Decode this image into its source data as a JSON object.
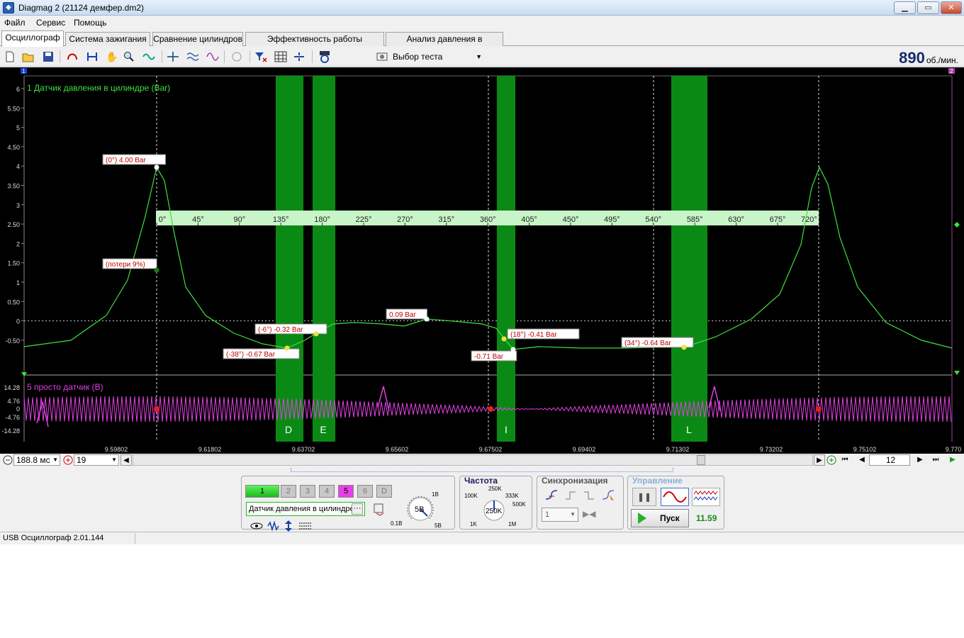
{
  "window": {
    "title": "Diagmag 2 (21124 демфер.dm2)",
    "min_label": "▁",
    "max_label": "▭",
    "close_label": "✕"
  },
  "menu": [
    "Файл",
    "Сервис",
    "Помощь"
  ],
  "tabs": [
    "Осциллограф",
    "Система зажигания",
    "Сравнение цилиндров",
    "Эффективность работы цилиндров",
    "Анализ давления в цилиндре"
  ],
  "toolbar": {
    "test_select": "Выбор теста",
    "rpm_value": "890",
    "rpm_unit": "об./мин."
  },
  "scope": {
    "channel1_label": "1 Датчик давления в цилиндре (Bar)",
    "channel5_label": "5 просто датчик (В)",
    "y_ticks_ch1": [
      "6",
      "5.50",
      "5",
      "4.50",
      "4",
      "3.50",
      "3",
      "2.50",
      "2",
      "1.50",
      "1",
      "0.50",
      "0",
      "-0.50"
    ],
    "y_ticks_ch5": [
      "14.28",
      "4.76",
      "0",
      "-4.76",
      "-14.28"
    ],
    "degree_ticks": [
      "0°",
      "45°",
      "90°",
      "135°",
      "180°",
      "225°",
      "270°",
      "315°",
      "360°",
      "405°",
      "450°",
      "495°",
      "540°",
      "585°",
      "630°",
      "675°",
      "720°"
    ],
    "time_ticks": [
      "9.59802",
      "9.61802",
      "9.63702",
      "9.65602",
      "9.67502",
      "9.69402",
      "9.71302",
      "9.73202",
      "9.75102",
      "9.770"
    ],
    "zone_letters": [
      "D",
      "E",
      "I",
      "L"
    ],
    "annotations": [
      "(0°) 4.00 Bar",
      "(потери 9%)",
      "(-6°) -0.32 Bar",
      "(-38°) -0.67 Bar",
      "0.09 Bar",
      "(18°) -0.41 Bar",
      "-0.71 Bar",
      "(34°) -0.64 Bar"
    ],
    "marker_left": "1",
    "marker_right": "2",
    "colors": {
      "ch1": "#3ee03e",
      "ch5": "#e040e0",
      "zone": "#0a8a14",
      "ruler": "#c8f5c8",
      "label_bg": "#ffffff",
      "label_fg": "#c00000"
    }
  },
  "bottom": {
    "timebase": "188.8 мс",
    "trigger_num": "19",
    "page_num": "12"
  },
  "channels": {
    "buttons": [
      "1",
      "2",
      "3",
      "4",
      "5",
      "6",
      "D"
    ],
    "sensor": "Датчик давления в цилиндре",
    "knob_value": "5В",
    "knob_min": "0.1В",
    "knob_max": "5В",
    "knob_mid": "1В"
  },
  "frequency": {
    "title": "Частота",
    "value": "250K",
    "labels": [
      "100K",
      "250K",
      "333K",
      "500K",
      "1K",
      "1M"
    ]
  },
  "sync": {
    "title": "Синхронизация",
    "channel": "1"
  },
  "control": {
    "title": "Управление",
    "start_label": "Пуск",
    "value": "11.59"
  },
  "status": {
    "text": "USB Осциллограф  2.01.144"
  }
}
